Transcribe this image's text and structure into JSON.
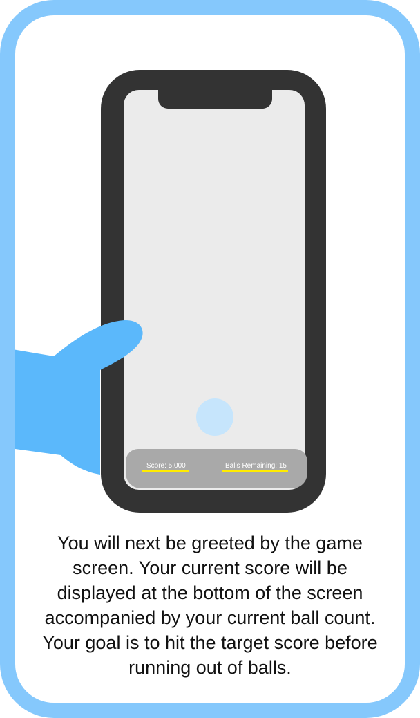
{
  "hud": {
    "score_label": "Score: 5,000",
    "balls_label": "Balls Remaining: 15"
  },
  "caption": {
    "text": "You will next be greeted by the game screen. Your current score will be displayed at the bottom of the screen accompanied by your current ball count. Your goal is to hit the target score before running out of balls."
  },
  "colors": {
    "card_border": "#85c8fc",
    "phone_frame": "#333333",
    "phone_screen": "#ebebeb",
    "hud_background": "#a9a9a9",
    "hud_underline": "#ffeb00",
    "hand": "#5bb8fb",
    "ball": "#c6e5fc"
  }
}
